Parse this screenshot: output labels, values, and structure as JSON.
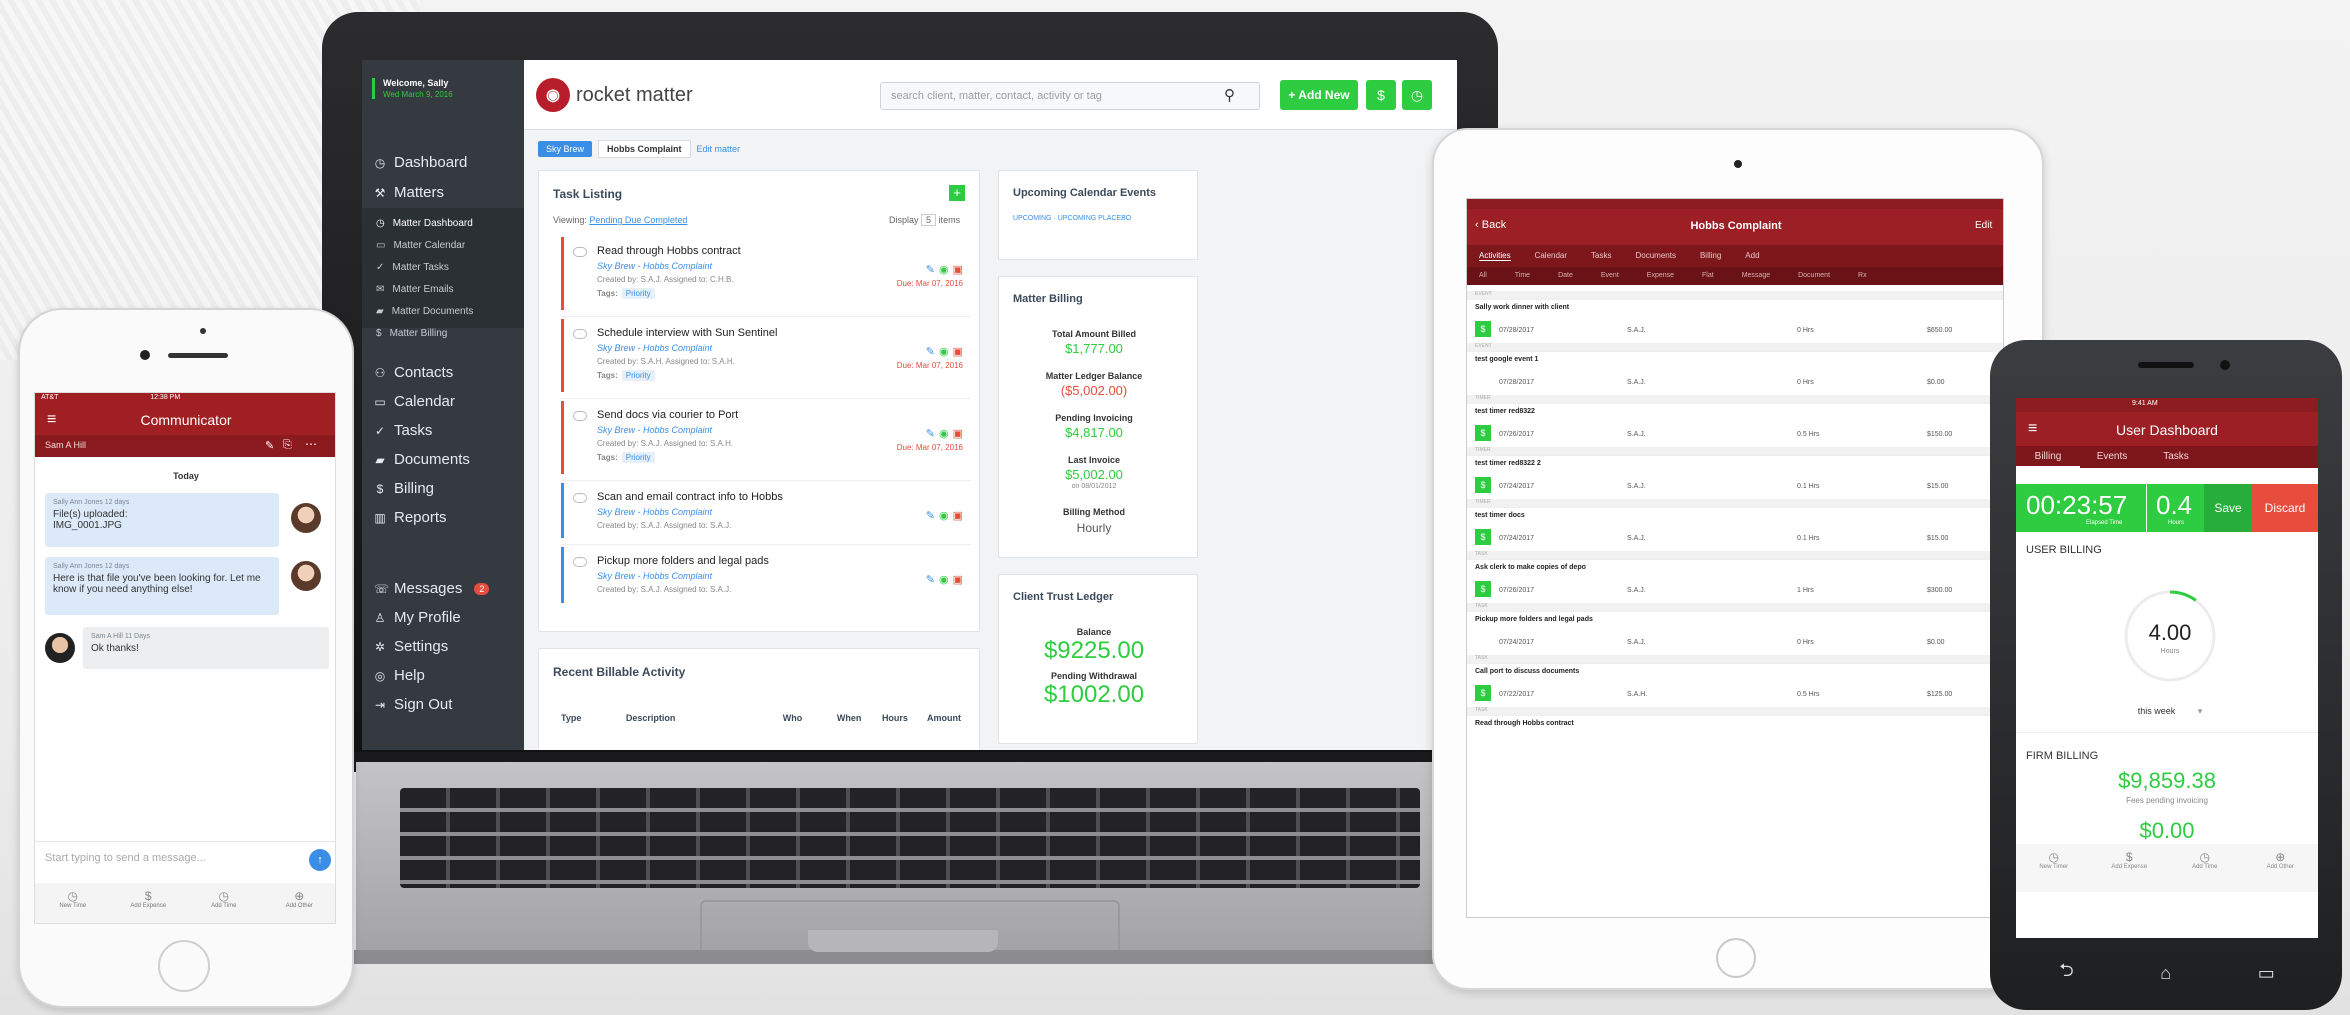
{
  "laptop": {
    "sidebar": {
      "welcome": "Welcome, Sally",
      "date": "Wed March 9, 2016",
      "items": [
        {
          "label": "Dashboard",
          "icon": "clock-icon"
        },
        {
          "label": "Matters",
          "icon": "hammer-icon"
        }
      ],
      "matter_subitems": [
        "Matter Dashboard",
        "Matter Calendar",
        "Matter Tasks",
        "Matter Emails",
        "Matter Documents",
        "Matter Billing"
      ],
      "items2": [
        {
          "label": "Contacts",
          "icon": "contacts-icon"
        },
        {
          "label": "Calendar",
          "icon": "calendar-icon"
        },
        {
          "label": "Tasks",
          "icon": "check-icon"
        },
        {
          "label": "Documents",
          "icon": "folder-icon"
        },
        {
          "label": "Billing",
          "icon": "dollar-icon"
        },
        {
          "label": "Reports",
          "icon": "chart-icon"
        }
      ],
      "items3": [
        {
          "label": "Messages",
          "icon": "phone-icon",
          "badge": "2"
        },
        {
          "label": "My Profile",
          "icon": "person-icon"
        },
        {
          "label": "Settings",
          "icon": "gear-icon"
        },
        {
          "label": "Help",
          "icon": "help-icon"
        },
        {
          "label": "Sign Out",
          "icon": "signout-icon"
        }
      ]
    },
    "topbar": {
      "logo_text": "rocket matter",
      "search_placeholder": "search client, matter, contact, activity or tag",
      "add_new": "+ Add New"
    },
    "breadcrumb": {
      "first": "Sky Brew",
      "second": "Hobbs Complaint",
      "edit": "Edit matter"
    },
    "task_listing": {
      "title": "Task Listing",
      "viewing_label": "Viewing:",
      "viewing_value": "Pending Due Completed",
      "display_label": "Display",
      "display_value": "5",
      "display_suffix": "items",
      "tasks": [
        {
          "title": "Read through Hobbs contract",
          "matter": "Sky Brew - Hobbs Complaint",
          "meta": "Created by: S.A.J. Assigned to: C.H.B.",
          "tags": "Tags:",
          "tag": "Priority",
          "due": "Due: Mar 07, 2016",
          "color": "red"
        },
        {
          "title": "Schedule interview with Sun Sentinel",
          "matter": "Sky Brew - Hobbs Complaint",
          "meta": "Created by: S.A.H. Assigned to: S.A.H.",
          "tags": "Tags:",
          "tag": "Priority",
          "due": "Due: Mar 07, 2016",
          "color": "red"
        },
        {
          "title": "Send docs via courier to Port",
          "matter": "Sky Brew - Hobbs Complaint",
          "meta": "Created by: S.A.J. Assigned to: S.A.H.",
          "tags": "Tags:",
          "tag": "Priority",
          "due": "Due: Mar 07, 2016",
          "color": "red"
        },
        {
          "title": "Scan and email contract info to Hobbs",
          "matter": "Sky Brew - Hobbs Complaint",
          "meta": "Created by: S.A.J. Assigned to: S.A.J.",
          "tags": "",
          "tag": "",
          "due": "",
          "color": "blue"
        },
        {
          "title": "Pickup more folders and legal pads",
          "matter": "Sky Brew - Hobbs Complaint",
          "meta": "Created by: S.A.J. Assigned to: S.A.J.",
          "tags": "",
          "tag": "",
          "due": "",
          "color": "blue"
        }
      ]
    },
    "recent_activity": {
      "title": "Recent Billable Activity",
      "columns": [
        "Type",
        "Description",
        "Who",
        "When",
        "Hours",
        "Amount"
      ]
    },
    "calendar": {
      "title": "Upcoming Calendar Events",
      "links": "UPCOMING · UPCOMING PLACEBO"
    },
    "billing": {
      "title": "Matter Billing",
      "rows": [
        {
          "label": "Total Amount Billed",
          "value": "$1,777.00",
          "color": "#2ecc40"
        },
        {
          "label": "Matter Ledger Balance",
          "value": "($5,002.00)",
          "color": "#e74c3c"
        },
        {
          "label": "Pending Invoicing",
          "value": "$4,817.00",
          "color": "#2ecc40"
        },
        {
          "label": "Last Invoice",
          "value": "$5,002.00",
          "sub": "on 08/01/2012",
          "color": "#2ecc40"
        },
        {
          "label": "Billing Method",
          "value": "Hourly",
          "color": "#555"
        }
      ]
    },
    "trust": {
      "title": "Client Trust Ledger",
      "balance_label": "Balance",
      "balance": "$9225.00",
      "pending_label": "Pending Withdrawal",
      "pending": "$1002.00"
    }
  },
  "iphone": {
    "status_left": "AT&T",
    "status_time": "12:38 PM",
    "title": "Communicator",
    "subtitle": "Sam A Hill",
    "day": "Today",
    "messages": [
      {
        "by": "Sally Ann Jones 12 days",
        "text": "File(s) uploaded:\nIMG_0001.JPG"
      },
      {
        "by": "Sally Ann Jones 12 days",
        "text": "Here is that file you've been looking for. Let me know if you need anything else!"
      },
      {
        "by": "Sam A Hill 11 Days",
        "text": "Ok thanks!"
      }
    ],
    "input_placeholder": "Start typing to send a message...",
    "tabs": [
      "New Time",
      "Add Expense",
      "Add Time",
      "Add Other"
    ]
  },
  "ipad": {
    "back": "Back",
    "title": "Hobbs Complaint",
    "edit": "Edit",
    "tabs": [
      "Activities",
      "Calendar",
      "Tasks",
      "Documents",
      "Billing",
      "Add"
    ],
    "columns": [
      "All",
      "Time",
      "Date",
      "Event",
      "Expense",
      "Flat",
      "Message",
      "Document",
      "Rx"
    ],
    "entries": [
      {
        "type": "EVENT",
        "title": "Sally work dinner with client",
        "date": "07/28/2017",
        "who": "S.A.J.",
        "time": "0 Hrs",
        "amt": "$650.00",
        "icon": true
      },
      {
        "type": "EVENT",
        "title": "test google event 1",
        "date": "07/28/2017",
        "who": "S.A.J.",
        "time": "0 Hrs",
        "amt": "$0.00",
        "icon": false
      },
      {
        "type": "TIMER",
        "title": "test timer red8322",
        "date": "07/26/2017",
        "who": "S.A.J.",
        "time": "0.5 Hrs",
        "amt": "$150.00",
        "icon": true
      },
      {
        "type": "TIMER",
        "title": "test timer red8322 2",
        "date": "07/24/2017",
        "who": "S.A.J.",
        "time": "0.1 Hrs",
        "amt": "$15.00",
        "icon": true
      },
      {
        "type": "TIMER",
        "title": "test timer docs",
        "date": "07/24/2017",
        "who": "S.A.J.",
        "time": "0.1 Hrs",
        "amt": "$15.00",
        "icon": true
      },
      {
        "type": "TASK",
        "title": "Ask clerk to make copies of depo",
        "date": "07/26/2017",
        "who": "S.A.J.",
        "time": "1 Hrs",
        "amt": "$300.00",
        "icon": true
      },
      {
        "type": "TASK",
        "title": "Pickup more folders and legal pads",
        "date": "07/24/2017",
        "who": "S.A.J.",
        "time": "0 Hrs",
        "amt": "$0.00",
        "icon": false
      },
      {
        "type": "TASK",
        "title": "Call port to discuss documents",
        "date": "07/22/2017",
        "who": "S.A.H.",
        "time": "0.5 Hrs",
        "amt": "$125.00",
        "icon": true
      },
      {
        "type": "TASK",
        "title": "Read through Hobbs contract",
        "date": "",
        "who": "",
        "time": "",
        "amt": "",
        "icon": false
      }
    ]
  },
  "android": {
    "status_time": "9:41 AM",
    "title": "User Dashboard",
    "tabs": [
      "Billing",
      "Events",
      "Tasks"
    ],
    "timer": "00:23:57",
    "timer_sub": "Elapsed Time",
    "hours": "0.4",
    "hours_sub": "Hours",
    "save": "Save",
    "discard": "Discard",
    "user_billing": "USER BILLING",
    "gauge_value": "4.00",
    "gauge_unit": "Hours",
    "gauge_fraction": 0.1,
    "period": "this week",
    "firm_billing": "FIRM BILLING",
    "fees": "$9,859.38",
    "fees_label": "Fees pending invoicing",
    "next": "$0.00",
    "bottom_tabs": [
      "New Timer",
      "Add Expense",
      "Add Time",
      "Add Other"
    ]
  }
}
